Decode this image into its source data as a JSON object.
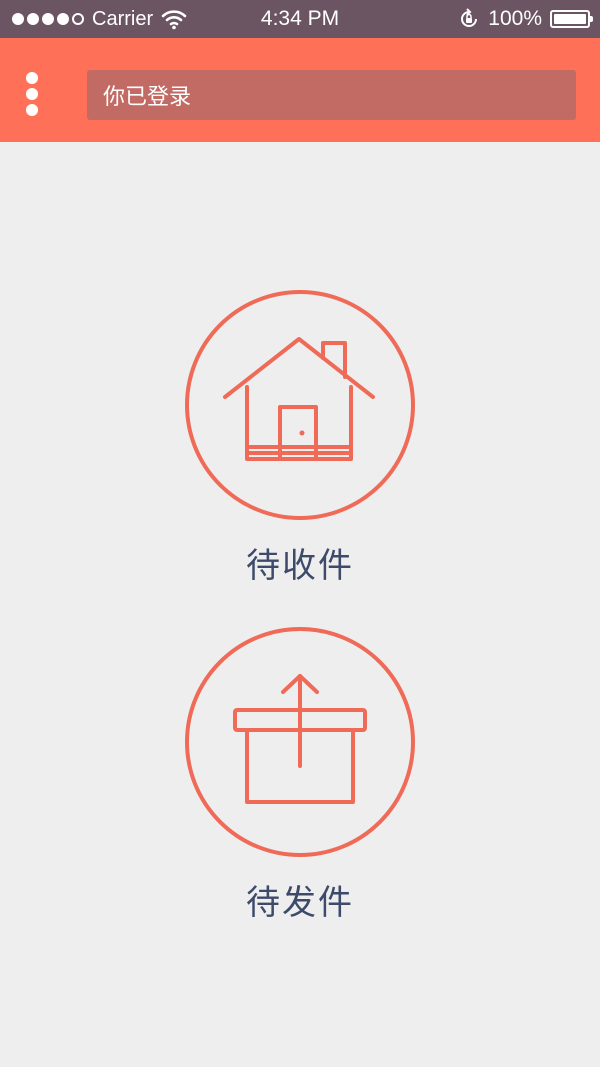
{
  "status_bar": {
    "carrier": "Carrier",
    "time": "4:34 PM",
    "battery": "100%",
    "signal_icon": "signal-dots-icon",
    "wifi_icon": "wifi-icon",
    "lock_icon": "rotation-lock-icon",
    "battery_icon": "battery-icon"
  },
  "header": {
    "status_text": "你已登录",
    "menu_icon": "more-vertical-icon",
    "color": "#ff7059"
  },
  "actions": [
    {
      "label": "待收件",
      "icon": "house-icon"
    },
    {
      "label": "待发件",
      "icon": "box-upload-icon"
    }
  ],
  "colors": {
    "accent": "#ef6a57",
    "label": "#3d4a6a",
    "background": "#eeeeee"
  }
}
